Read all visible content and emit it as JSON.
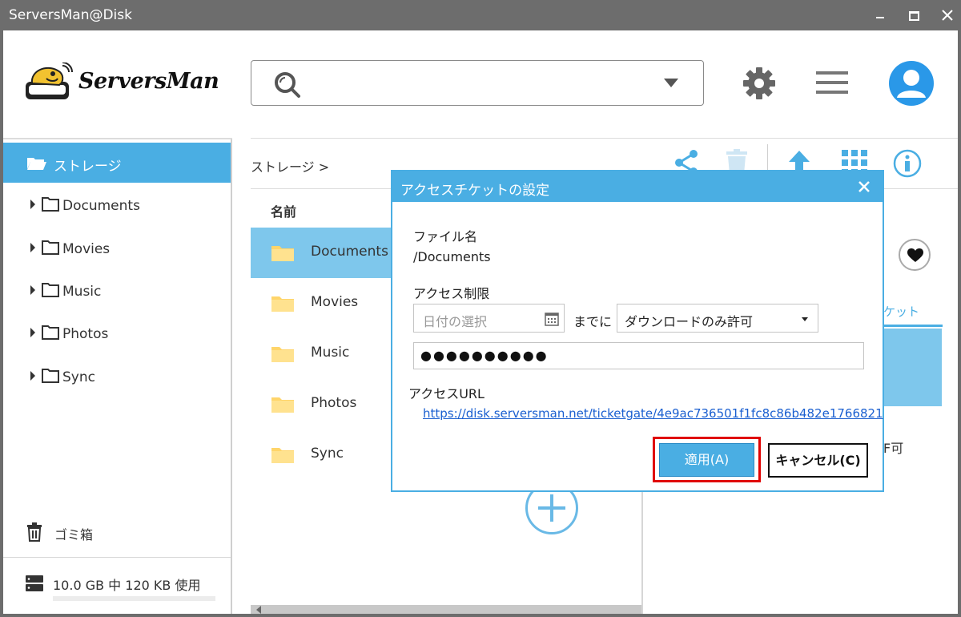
{
  "window": {
    "title": "ServersMan@Disk"
  },
  "logo": {
    "text": "ServersMan"
  },
  "header": {
    "search": {
      "value": "",
      "placeholder": ""
    }
  },
  "sidebar": {
    "root_label": "ストレージ",
    "items": [
      {
        "label": "Documents"
      },
      {
        "label": "Movies"
      },
      {
        "label": "Music"
      },
      {
        "label": "Photos"
      },
      {
        "label": "Sync"
      }
    ],
    "trash_label": "ゴミ箱",
    "storage_usage": "10.0 GB 中 120 KB 使用",
    "usage_fraction": 0.0001
  },
  "main": {
    "breadcrumb": "ストレージ >",
    "column_name": "名前",
    "files": [
      {
        "name": "Documents",
        "selected": true
      },
      {
        "name": "Movies",
        "selected": false
      },
      {
        "name": "Music",
        "selected": false
      },
      {
        "name": "Photos",
        "selected": false
      },
      {
        "name": "Sync",
        "selected": false
      }
    ]
  },
  "right_panel": {
    "tab_fragment": "ケット",
    "permission_fragment": "F可"
  },
  "dialog": {
    "title": "アクセスチケットの設定",
    "file_name_label": "ファイル名",
    "file_name_value": "/Documents",
    "access_limit_label": "アクセス制限",
    "date_placeholder": "日付の選択",
    "until_label": "までに",
    "permission_value": "ダウンロードのみ許可",
    "password_value": "●●●●●●●●●●",
    "access_url_label": "アクセスURL",
    "access_url": "https://disk.serversman.net/ticketgate/4e9ac736501f1fc8c86b482e1766821",
    "apply_label": "適用(A)",
    "cancel_label": "キャンセル(C)"
  },
  "colors": {
    "accent": "#4aaee3",
    "selection": "#7ec7ec",
    "titlebar": "#6d6d6d",
    "highlight_border": "#e00000",
    "link": "#1a5fd0",
    "avatar": "#2a98e8"
  }
}
